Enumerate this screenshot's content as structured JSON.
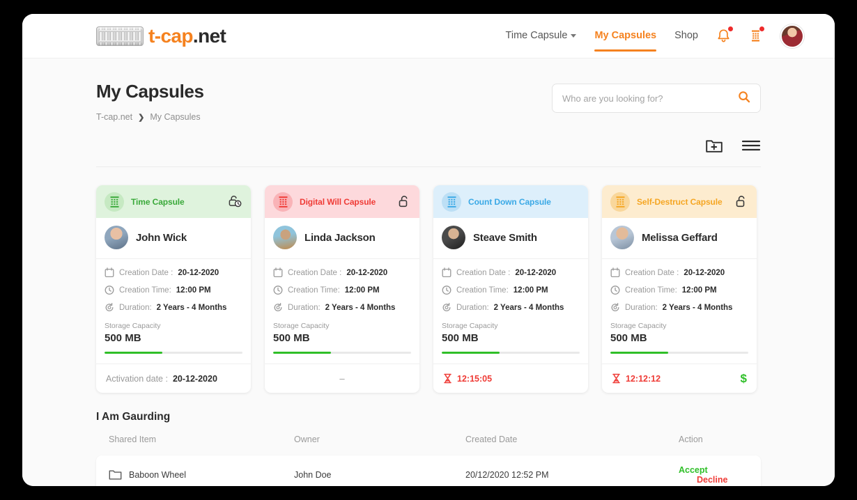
{
  "brand": {
    "name_orange": "t-cap",
    "name_dark": ".net",
    "logo_icon": "cryptex-logo-icon"
  },
  "nav": {
    "items": [
      {
        "label": "Time Capsule",
        "active": false,
        "has_caret": true
      },
      {
        "label": "My Capsules",
        "active": true,
        "has_caret": false
      },
      {
        "label": "Shop",
        "active": false,
        "has_caret": false
      }
    ],
    "bell_icon": "notification-bell-icon",
    "capsule_icon": "capsule-icon",
    "avatar_icon": "user-avatar"
  },
  "header": {
    "title": "My Capsules",
    "breadcrumb": {
      "root": "T-cap.net",
      "separator": "❯",
      "current": "My Capsules"
    }
  },
  "search": {
    "placeholder": "Who are you looking for?",
    "value": "",
    "icon": "search-icon"
  },
  "toolbar": {
    "add_folder_icon": "folder-plus-icon",
    "menu_icon": "hamburger-menu-icon"
  },
  "colors": {
    "accent": "#f5821f",
    "green": "#2fbf28",
    "red": "#ef3b36",
    "blue": "#3ba9e6",
    "orange": "#f5a623"
  },
  "cards": [
    {
      "type": "Time Capsule",
      "header_bg": "#dff3dd",
      "header_color": "#3aa93a",
      "badge_bg": "#c6e9c2",
      "locked_icon": "unlock-clock-icon",
      "has_lock": true,
      "user": "John Wick",
      "creation_date_label": "Creation Date :",
      "creation_date": "20-12-2020",
      "creation_time_label": "Creation Time:",
      "creation_time": "12:00 PM",
      "duration_label": "Duration:",
      "duration": "2 Years - 4 Months",
      "storage_label": "Storage Capacity",
      "storage_value": "500 MB",
      "storage_percent": 42,
      "footer_type": "activation",
      "footer_label": "Activation date :",
      "footer_value": "20-12-2020",
      "show_dollar": false
    },
    {
      "type": "Digital Will Capsule",
      "header_bg": "#fdd9dc",
      "header_color": "#ef3b36",
      "badge_bg": "#f9b3b7",
      "locked_icon": "unlock-icon",
      "has_lock": true,
      "user": "Linda Jackson",
      "creation_date_label": "Creation Date :",
      "creation_date": "20-12-2020",
      "creation_time_label": "Creation Time:",
      "creation_time": "12:00 PM",
      "duration_label": "Duration:",
      "duration": "2 Years - 4 Months",
      "storage_label": "Storage Capacity",
      "storage_value": "500 MB",
      "storage_percent": 42,
      "footer_type": "dash",
      "footer_label": "",
      "footer_value": "–",
      "show_dollar": false
    },
    {
      "type": "Count Down Capsule",
      "header_bg": "#ddeffb",
      "header_color": "#3ba9e6",
      "badge_bg": "#bcdff5",
      "locked_icon": "",
      "has_lock": false,
      "user": "Steave Smith",
      "creation_date_label": "Creation Date :",
      "creation_date": "20-12-2020",
      "creation_time_label": "Creation Time:",
      "creation_time": "12:00 PM",
      "duration_label": "Duration:",
      "duration": "2 Years - 4 Months",
      "storage_label": "Storage Capacity",
      "storage_value": "500 MB",
      "storage_percent": 42,
      "footer_type": "timer",
      "footer_label": "",
      "footer_value": "12:15:05",
      "show_dollar": false
    },
    {
      "type": "Self-Destruct Capsule",
      "header_bg": "#fdeccf",
      "header_color": "#f5a623",
      "badge_bg": "#f9d79b",
      "locked_icon": "unlock-icon",
      "has_lock": true,
      "user": "Melissa Geffard",
      "creation_date_label": "Creation Date :",
      "creation_date": "20-12-2020",
      "creation_time_label": "Creation Time:",
      "creation_time": "12:00 PM",
      "duration_label": "Duration:",
      "duration": "2 Years - 4 Months",
      "storage_label": "Storage Capacity",
      "storage_value": "500 MB",
      "storage_percent": 42,
      "footer_type": "timer",
      "footer_label": "",
      "footer_value": "12:12:12",
      "show_dollar": true,
      "dollar_symbol": "$"
    }
  ],
  "guarding": {
    "title": "I Am Gaurding",
    "columns": [
      "Shared Item",
      "Owner",
      "Created Date",
      "Action"
    ],
    "rows": [
      {
        "item": "Baboon Wheel",
        "item_icon": "folder-icon",
        "owner": "John Doe",
        "created_date": "20/12/2020 12:52 PM",
        "accept": "Accept",
        "decline": "Decline"
      }
    ]
  },
  "icons": {
    "calendar": "calendar-icon",
    "clock": "clock-icon",
    "duration": "rotation-refresh-icon",
    "hourglass": "hourglass-icon"
  }
}
